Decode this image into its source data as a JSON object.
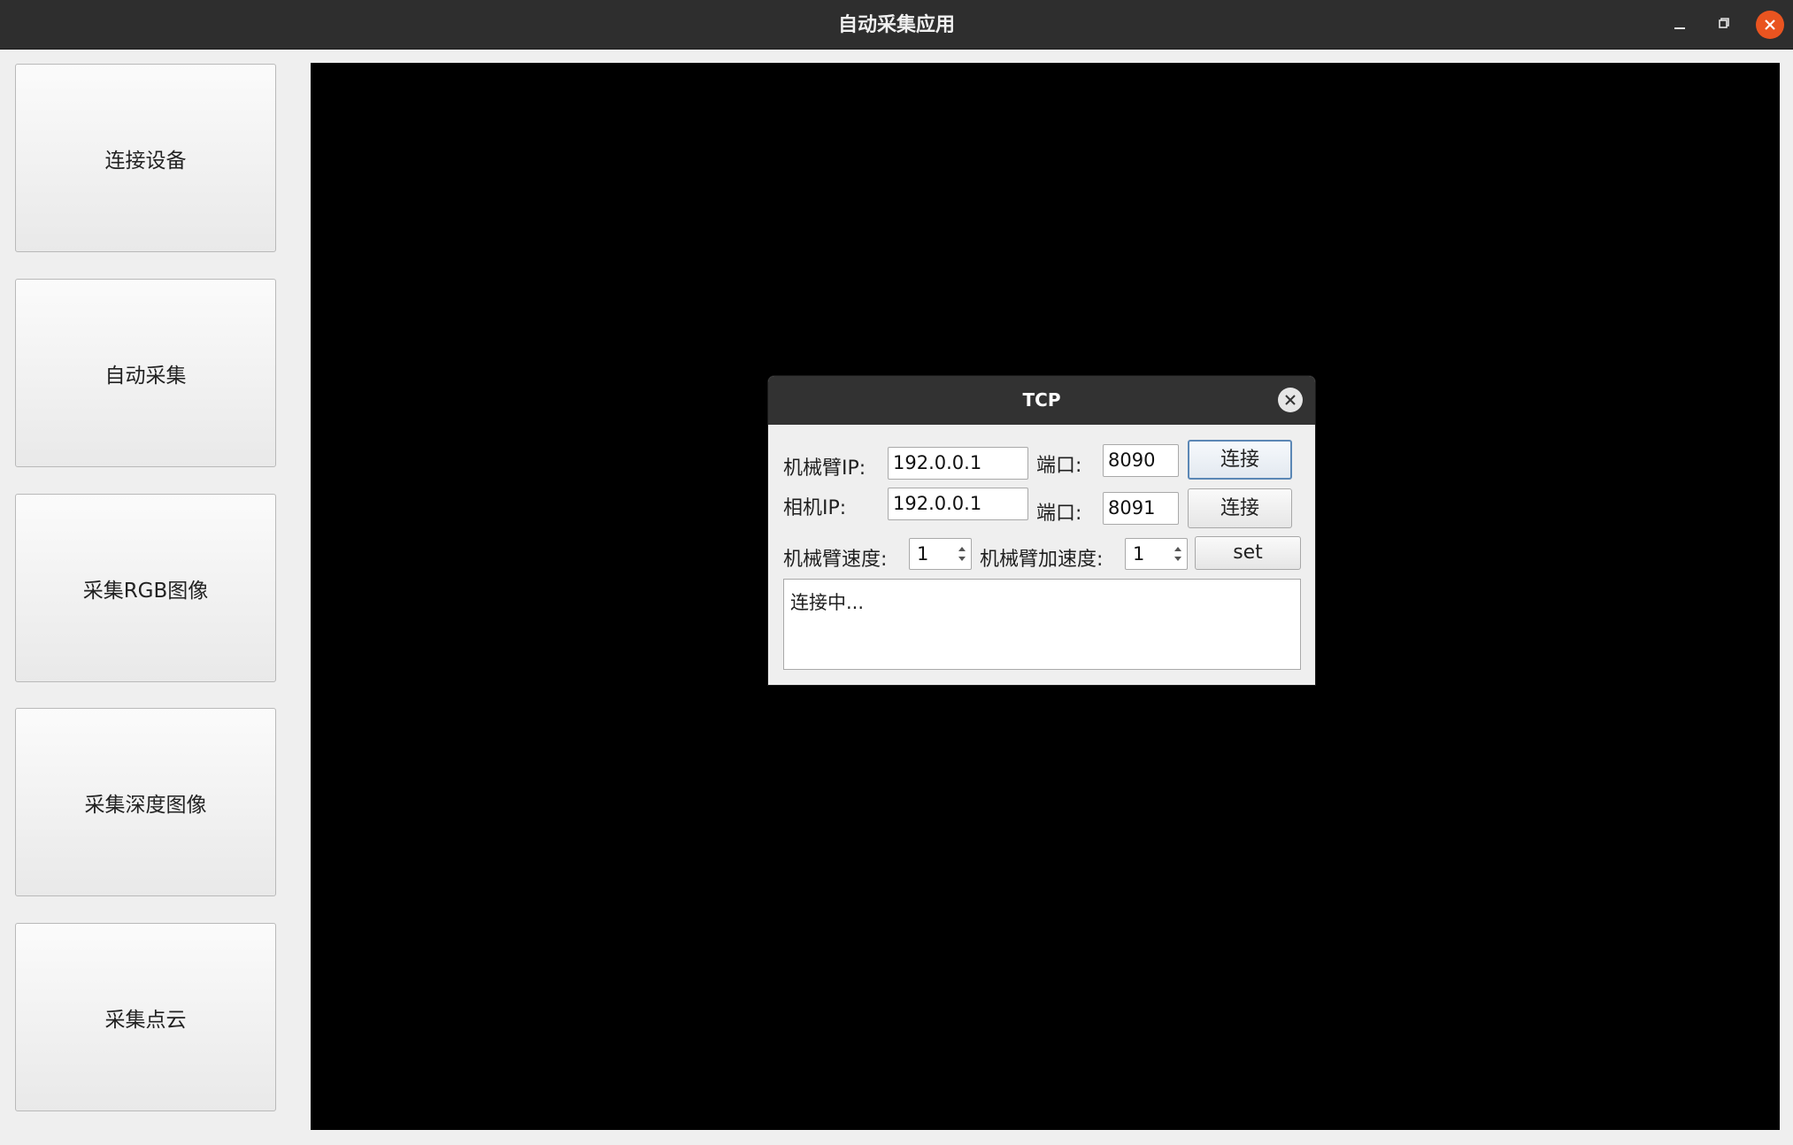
{
  "window": {
    "title": "自动采集应用"
  },
  "sidebar": {
    "buttons": [
      {
        "label": "连接设备"
      },
      {
        "label": "自动采集"
      },
      {
        "label": "采集RGB图像"
      },
      {
        "label": "采集深度图像"
      },
      {
        "label": "采集点云"
      }
    ]
  },
  "dialog": {
    "title": "TCP",
    "arm": {
      "ip_label": "机械臂IP:",
      "ip_value": "192.0.0.1",
      "port_label": "端口:",
      "port_value": "8090",
      "connect_label": "连接"
    },
    "camera": {
      "ip_label": "相机IP:",
      "ip_value": "192.0.0.1",
      "port_label": "端口:",
      "port_value": "8091",
      "connect_label": "连接"
    },
    "speed": {
      "label": "机械臂速度:",
      "value": "1"
    },
    "accel": {
      "label": "机械臂加速度:",
      "value": "1"
    },
    "set_label": "set",
    "log_text": "连接中..."
  },
  "colors": {
    "titlebar": "#2e2e2e",
    "close_accent": "#e95420",
    "viewer": "#000000",
    "focus_border": "#5b87b5"
  },
  "icons": {
    "minimize": "minimize-icon",
    "maximize": "maximize-icon",
    "close": "close-icon",
    "dialog_close": "close-icon"
  }
}
